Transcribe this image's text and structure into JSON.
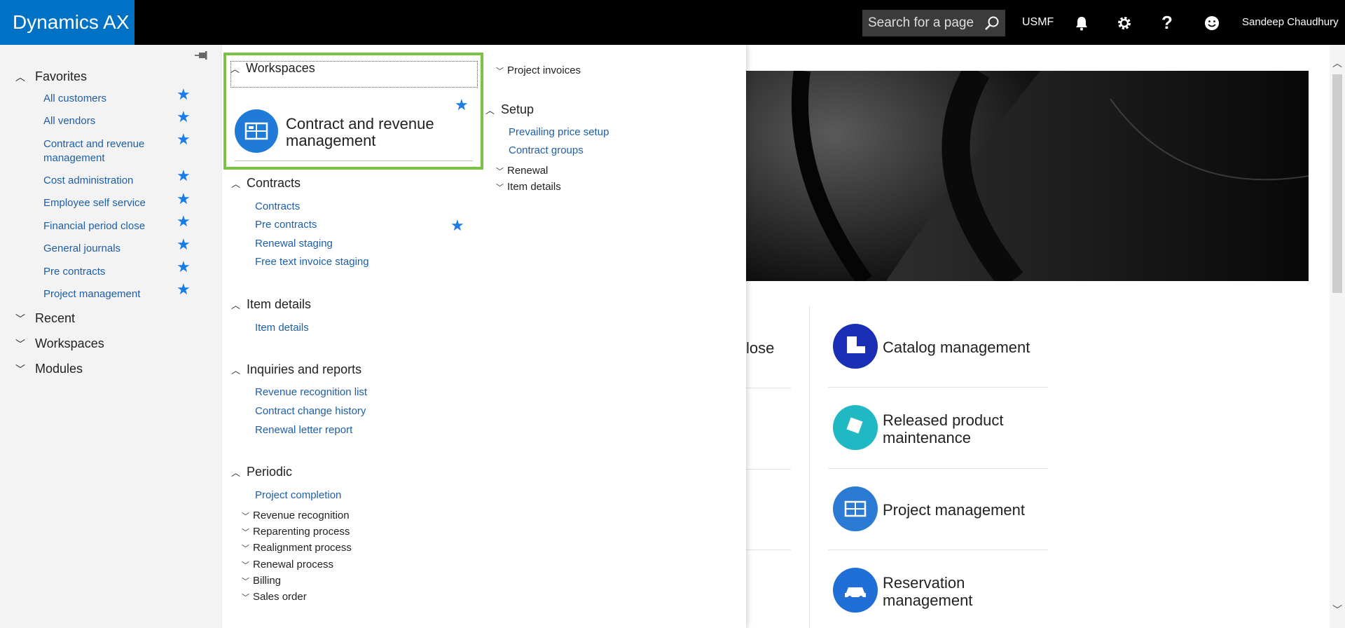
{
  "topbar": {
    "app_title": "Dynamics AX",
    "search_placeholder": "Search for a page",
    "company": "USMF",
    "user": "Sandeep Chaudhury"
  },
  "leftnav": {
    "favorites_label": "Favorites",
    "favorites": [
      "All customers",
      "All vendors",
      "Contract and revenue management",
      "Cost administration",
      "Employee self service",
      "Financial period close",
      "General journals",
      "Pre contracts",
      "Project management"
    ],
    "recent_label": "Recent",
    "workspaces_label": "Workspaces",
    "modules_label": "Modules"
  },
  "flyout": {
    "workspaces_label": "Workspaces",
    "workspace_tile": "Contract and revenue management",
    "contracts_label": "Contracts",
    "contracts": [
      "Contracts",
      "Pre contracts",
      "Renewal staging",
      "Free text invoice staging"
    ],
    "item_details_label": "Item details",
    "item_details": [
      "Item details"
    ],
    "inquiries_label": "Inquiries and reports",
    "inquiries": [
      "Revenue recognition list",
      "Contract change history",
      "Renewal letter report"
    ],
    "periodic_label": "Periodic",
    "periodic_links": [
      "Project completion"
    ],
    "periodic_sub": [
      "Revenue recognition",
      "Reparenting process",
      "Realignment process",
      "Renewal process",
      "Billing",
      "Sales order"
    ],
    "project_invoices": "Project invoices",
    "setup_label": "Setup",
    "setup_links": [
      "Prevailing price setup",
      "Contract groups"
    ],
    "setup_sub": [
      "Renewal",
      "Item details"
    ]
  },
  "workspace_tiles": [
    {
      "label": "Catalog management",
      "color": "#1a2fb5"
    },
    {
      "label": "Released product maintenance",
      "color": "#1fb8c3"
    },
    {
      "label": "Project management",
      "color": "#2b7bd4"
    },
    {
      "label": "Reservation management",
      "color": "#1f6fd6"
    }
  ],
  "partial_tile_text": "lose",
  "colors": {
    "brand": "#0072c6",
    "link": "#1e5ea8",
    "star": "#1a7ce6",
    "highlight": "#7cc242"
  }
}
